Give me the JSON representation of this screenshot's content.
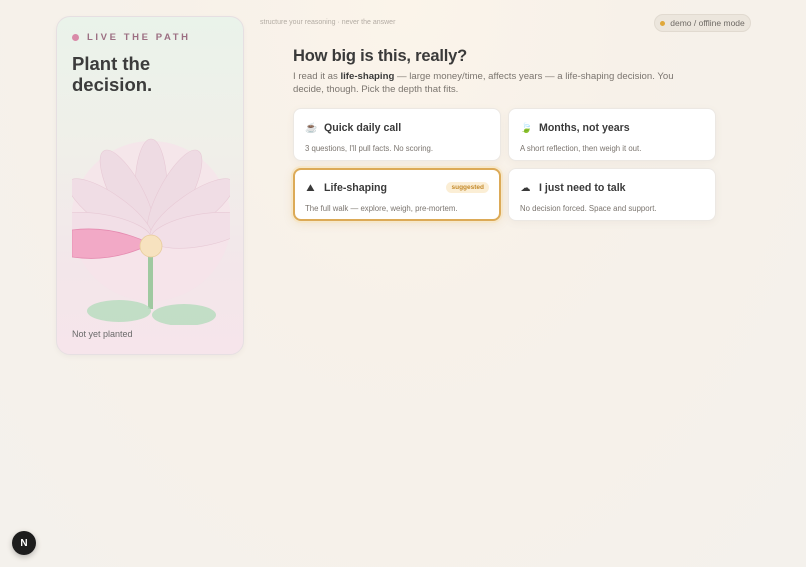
{
  "sidebar": {
    "eyebrow": "LIVE THE PATH",
    "title": "Plant the decision.",
    "status": "Not yet planted",
    "accent": "#d98aa8"
  },
  "header": {
    "tagline": "structure your reasoning · never the answer",
    "mode": "demo / offline mode",
    "mode_dot_color": "#e0a83a"
  },
  "main": {
    "heading": "How big is this, really?",
    "lede_prefix": "I read it as ",
    "lede_bold": "life-shaping",
    "lede_suffix": " — large money/time, affects years — a life-shaping decision. You decide, though. Pick the depth that fits."
  },
  "options": [
    {
      "icon": "coffee-icon",
      "glyph": "☕",
      "title": "Quick daily call",
      "desc": "3 questions, I'll pull facts. No scoring."
    },
    {
      "icon": "leaf-icon",
      "glyph": "🍃",
      "title": "Months, not years",
      "desc": "A short reflection, then weigh it out."
    },
    {
      "icon": "mountain-icon",
      "glyph": "⛰",
      "title": "Life-shaping",
      "desc": "The full walk — explore, weigh, pre-mortem.",
      "badge": "suggested"
    },
    {
      "icon": "rain-cloud-icon",
      "glyph": "☁",
      "title": "I just need to talk",
      "desc": "No decision forced. Space and support."
    }
  ],
  "floating_button": {
    "label": "N"
  }
}
